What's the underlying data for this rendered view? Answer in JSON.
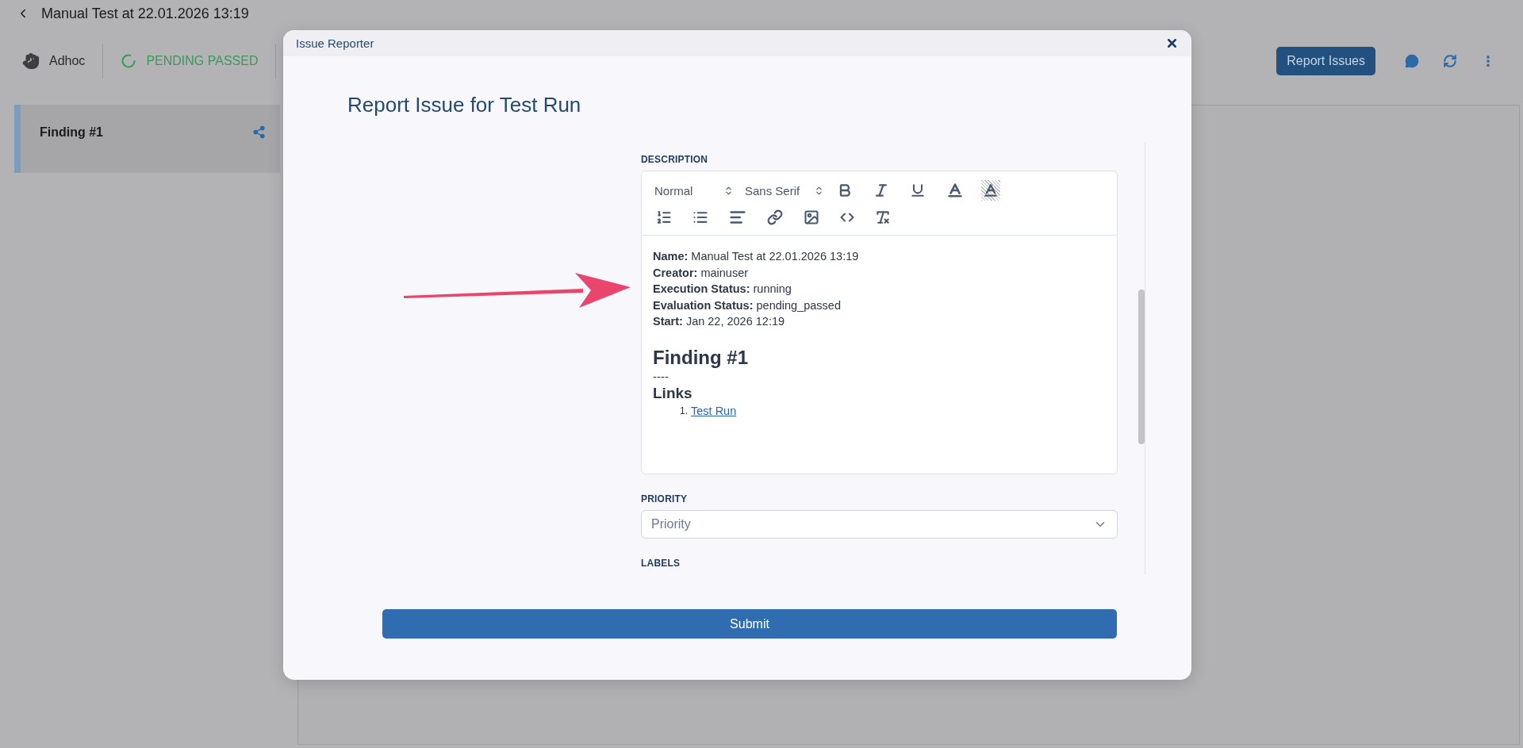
{
  "header": {
    "title": "Manual Test at 22.01.2026 13:19"
  },
  "toolbar": {
    "mode": "Adhoc",
    "status": "PENDING PASSED",
    "report_button": "Report Issues"
  },
  "sidebar": {
    "items": [
      {
        "label": "Finding #1",
        "selected": true
      }
    ]
  },
  "dialog": {
    "title": "Issue Reporter",
    "heading": "Report Issue for Test Run",
    "description": {
      "label": "DESCRIPTION",
      "header_format": "Normal",
      "font": "Sans Serif",
      "lines": [
        "**Name:** Manual Test at 22.01.2026 13:19",
        "**Creator:** mainuser",
        "**Execution Status:** running",
        "**Evaluation Status:** pending_passed",
        "**Start:** Jan 22, 2026 12:19"
      ],
      "heading": "Finding #1",
      "separator": "----",
      "subheading": "Links",
      "links": [
        {
          "number": "1.",
          "text": "Test Run"
        }
      ]
    },
    "priority": {
      "label": "PRIORITY",
      "placeholder": "Priority"
    },
    "labels": {
      "label": "LABELS"
    },
    "submit": "Submit"
  }
}
